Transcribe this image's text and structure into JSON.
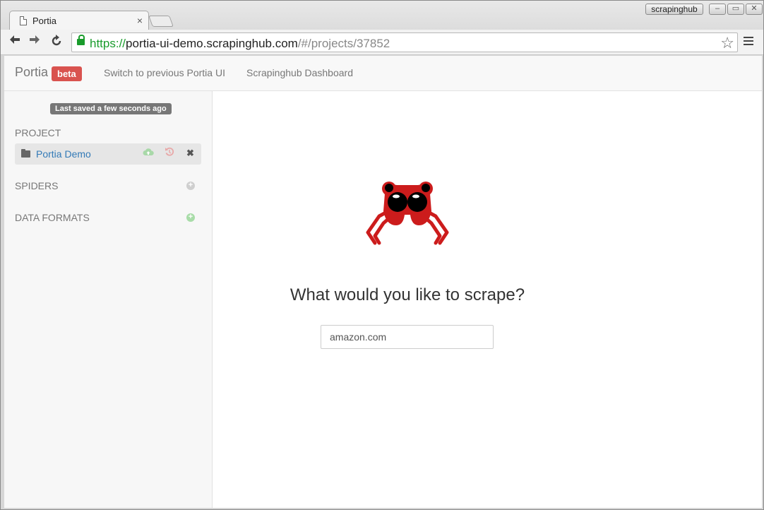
{
  "browser": {
    "tab_title": "Portia",
    "tab_close": "×",
    "profile_name": "scrapinghub",
    "url_scheme": "https://",
    "url_host": "portia-ui-demo.scrapinghub.com",
    "url_path": "/#/projects/37852",
    "icons": {
      "back": "back-arrow-icon",
      "forward": "forward-arrow-icon",
      "reload": "reload-icon",
      "bookmark": "star-icon",
      "menu": "menu-icon"
    }
  },
  "navbar": {
    "brand": "Portia",
    "badge": "beta",
    "links": [
      "Switch to previous Portia UI",
      "Scrapinghub Dashboard"
    ]
  },
  "sidebar": {
    "saved_status": "Last saved a few seconds ago",
    "project_section": "PROJECT",
    "project_name": "Portia Demo",
    "spiders_section": "SPIDERS",
    "data_formats_section": "DATA FORMATS"
  },
  "main": {
    "headline": "What would you like to scrape?",
    "url_input_value": "amazon.com"
  },
  "colors": {
    "accent_red": "#d9534f",
    "link_blue": "#337ab7",
    "logo_red": "#cc1c1c",
    "secure_green": "#1a9c2c"
  }
}
